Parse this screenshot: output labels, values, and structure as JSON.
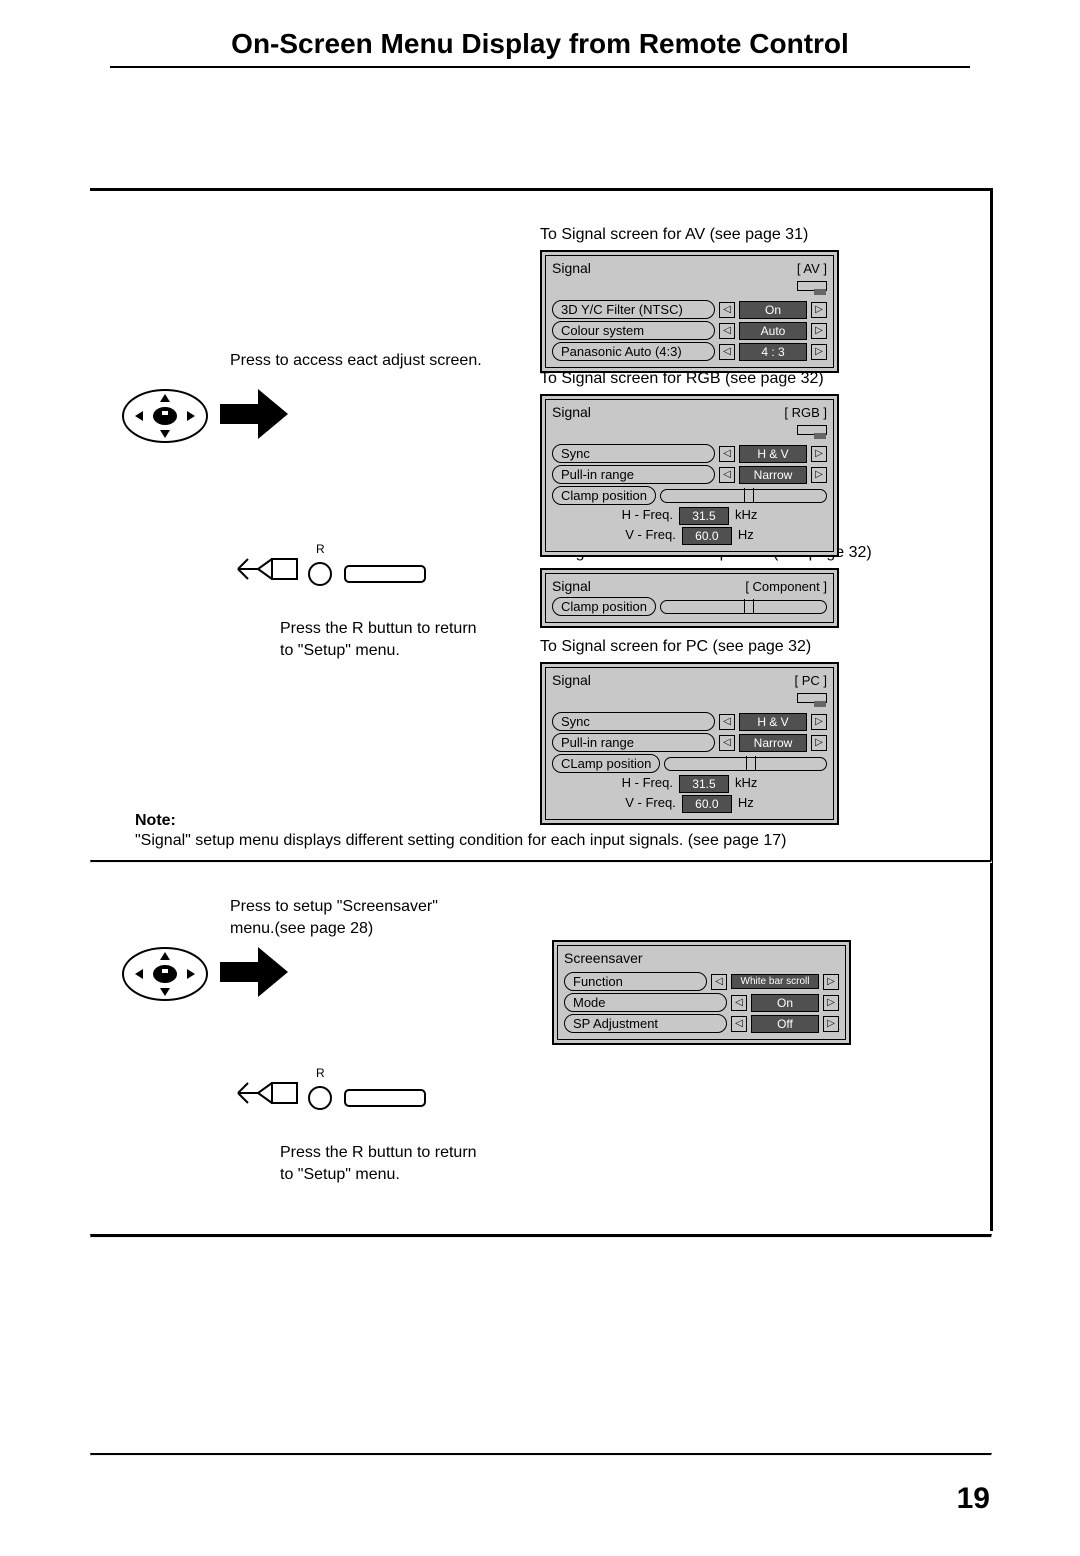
{
  "title": "On-Screen Menu Display from Remote Control",
  "page_number": "19",
  "instructions": {
    "press_access": "Press to access eact adjust screen.",
    "r_label": "R",
    "press_r_return_1": "Press the R buttun to return",
    "press_r_return_2": "to \"Setup\" menu.",
    "av_caption": "To Signal screen for AV  (see page 31)",
    "rgb_caption": "To Signal screen for RGB (see page 32)",
    "component_caption": "To Signal screen for Component (see page 32)",
    "pc_caption": "To Signal screen for PC (see page 32)",
    "screensaver_caption_1": "Press  to setup \"Screensaver\"",
    "screensaver_caption_2": "menu.(see page 28)"
  },
  "note": {
    "label": "Note:",
    "text": "\"Signal\" setup menu displays different setting condition for each input signals. (see page 17)"
  },
  "panels": {
    "av": {
      "title": "Signal",
      "mode": "AV",
      "rows": [
        {
          "label": "3D Y/C Filter (NTSC)",
          "value": "On"
        },
        {
          "label": "Colour system",
          "value": "Auto"
        },
        {
          "label": "Panasonic Auto (4:3)",
          "value": "4 : 3"
        }
      ]
    },
    "rgb": {
      "title": "Signal",
      "mode": "RGB",
      "rows": [
        {
          "label": "Sync",
          "value": "H & V"
        },
        {
          "label": "Pull-in range",
          "value": "Narrow"
        }
      ],
      "clamp_label": "Clamp position",
      "hfreq_label": "H - Freq.",
      "hfreq_val": "31.5",
      "hfreq_unit": "kHz",
      "vfreq_label": "V - Freq.",
      "vfreq_val": "60.0",
      "vfreq_unit": "Hz"
    },
    "component": {
      "title": "Signal",
      "mode": "Component",
      "clamp_label": "Clamp  position"
    },
    "pc": {
      "title": "Signal",
      "mode": "PC",
      "rows": [
        {
          "label": "Sync",
          "value": "H & V"
        },
        {
          "label": "Pull-in range",
          "value": "Narrow"
        }
      ],
      "clamp_label": "CLamp position",
      "hfreq_label": "H - Freq.",
      "hfreq_val": "31.5",
      "hfreq_unit": "kHz",
      "vfreq_label": "V - Freq.",
      "vfreq_val": "60.0",
      "vfreq_unit": "Hz"
    },
    "screensaver": {
      "title": "Screensaver",
      "rows": [
        {
          "label": "Function",
          "value": "White bar scroll"
        },
        {
          "label": "Mode",
          "value": "On"
        },
        {
          "label": "SP Adjustment",
          "value": "Off"
        }
      ]
    }
  }
}
